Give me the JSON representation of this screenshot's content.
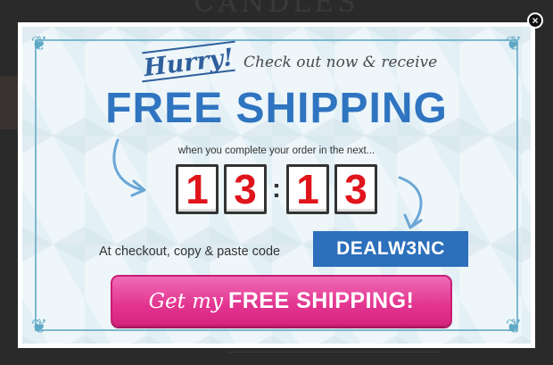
{
  "background": {
    "store_title": "CANDLES"
  },
  "modal": {
    "close_symbol": "×",
    "hurry": "Hurry!",
    "tagline": "Check out now & receive",
    "headline": "FREE SHIPPING",
    "subtext": "when you complete your order in the next...",
    "timer": {
      "digits": [
        "1",
        "3",
        "1",
        "3"
      ],
      "separator": ":"
    },
    "code_label": "At checkout, copy & paste code",
    "code": "DEALW3NC",
    "cta": {
      "script": "Get my",
      "main": "FREE SHIPPING!"
    }
  },
  "colors": {
    "headline_blue": "#2f74c0",
    "digit_red": "#e0141b",
    "cta_pink": "#e2348f",
    "code_blue": "#2c6fbb"
  },
  "icons": {
    "close": "close-icon",
    "arrows": "curved-arrow-icon",
    "corners": "flourish-icon"
  }
}
